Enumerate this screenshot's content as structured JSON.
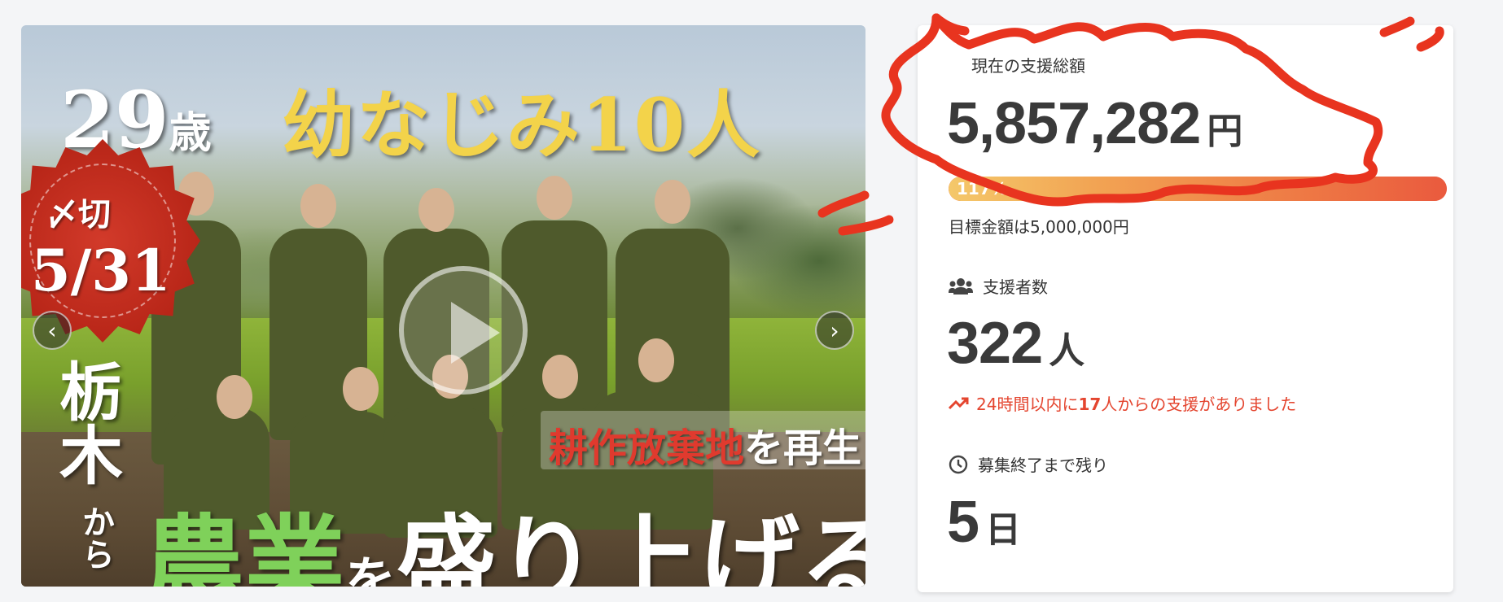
{
  "hero": {
    "age_number": "29",
    "age_suffix": "歳",
    "friends_title": "幼なじみ10人",
    "deadline_label": "〆切",
    "deadline_date": "5/31",
    "prefecture": "栃木",
    "from": "から",
    "reclaim_emphasis": "耕作放棄地",
    "reclaim_rest": "を再生",
    "slogan_green": "農業",
    "slogan_particle": "を",
    "slogan_rest": "盛り上げる",
    "prev_icon": "chevron-left-icon",
    "next_icon": "chevron-right-icon",
    "play_icon": "play-icon"
  },
  "stats": {
    "total_label": "現在の支援総額",
    "total_amount": "5,857,282",
    "total_unit": "円",
    "progress_percent_text": "117%",
    "progress_fraction": 1.17,
    "goal_text": "目標金額は5,000,000円",
    "supporters_label": "支援者数",
    "supporters_count": "322",
    "supporters_unit": "人",
    "recent_prefix": "24時間以内に",
    "recent_count": "17",
    "recent_suffix": "人からの支援がありました",
    "remaining_label": "募集終了まで残り",
    "remaining_count": "5",
    "remaining_unit": "日"
  },
  "colors": {
    "accent_red": "#e4452f",
    "progress_start": "#f4c86a",
    "progress_end": "#ea5a3e",
    "annotation_red": "#e8341f"
  }
}
